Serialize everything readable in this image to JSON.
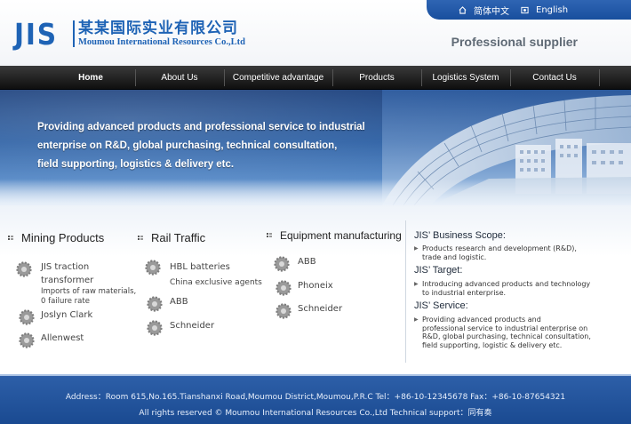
{
  "header": {
    "logo_mark": "JIS",
    "logo_cn": "某某国际实业有限公司",
    "logo_en": "Moumou International  Resources Co.,Ltd",
    "slogan": "Professional supplier",
    "languages": [
      "简体中文",
      "English"
    ]
  },
  "nav": {
    "items": [
      "Home",
      "About Us",
      "Competitive advantage",
      "Products",
      "Logistics System",
      "Contact Us"
    ],
    "active": "Home"
  },
  "banner": {
    "lines": [
      "Providing advanced products and professional service to industrial",
      "enterprise on R&D, global purchasing, technical consultation,",
      "field supporting, logistics & delivery etc."
    ]
  },
  "columns": [
    {
      "title": "Mining Products",
      "products": [
        {
          "name": "JIS traction transformer",
          "sub": "Imports of raw materials, 0 failure rate"
        },
        {
          "name": "Joslyn Clark"
        },
        {
          "name": "Allenwest"
        }
      ]
    },
    {
      "title": "Rail Traffic",
      "products": [
        {
          "name": "HBL batteries",
          "sub": "China exclusive agents"
        },
        {
          "name": "ABB"
        },
        {
          "name": "Schneider"
        }
      ]
    },
    {
      "title": "Equipment manufacturing",
      "products": [
        {
          "name": "ABB"
        },
        {
          "name": "Phoneix"
        },
        {
          "name": "Schneider"
        }
      ]
    }
  ],
  "scope": [
    {
      "title": "JIS’ Business Scope:",
      "text": [
        "Products research and development (R&D),",
        "trade and logistic."
      ]
    },
    {
      "title": "JIS’ Target:",
      "text": [
        "Introducing advanced products and technology",
        "to industrial enterprise."
      ]
    },
    {
      "title": "JIS’ Service:",
      "text": [
        "Providing advanced products and",
        "professional service to industrial enterprise on",
        "R&D, global purchasing, technical consultation,",
        "field supporting, logistic & delivery etc."
      ]
    }
  ],
  "footer": {
    "address": "Address：Room 615,No.165.Tianshanxi Road,Moumou District,Moumou,P.R.C Tel：+86-10-12345678 Fax：+86-10-87654321",
    "copyright": "All rights reserved © Moumou International Resources Co.,Ltd  Technical support：同有奏"
  },
  "colors": {
    "brand_blue": "#1e63b5",
    "nav_bg": "#1a1a1a",
    "footer_bg": "#2457a0"
  },
  "icons": [
    "home-icon",
    "globe-icon",
    "gear-icon",
    "list-bullet-icon",
    "arrow-bullet-icon"
  ]
}
